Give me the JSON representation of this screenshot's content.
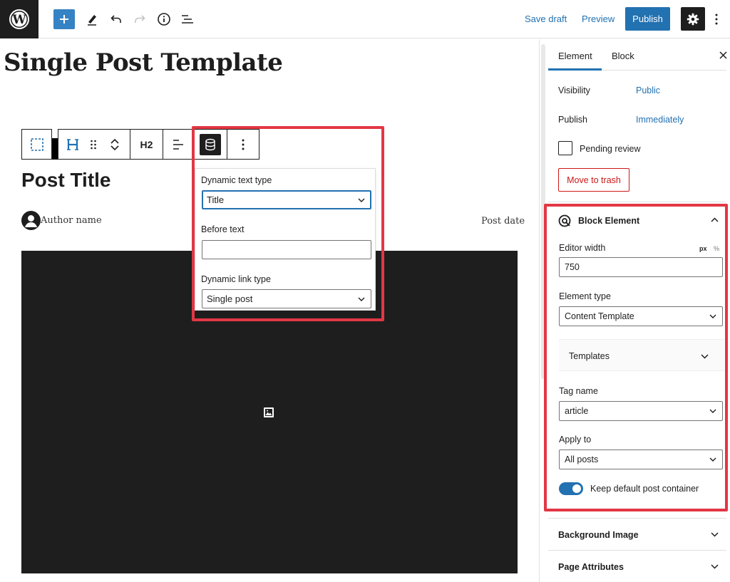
{
  "topbar": {
    "save_draft": "Save draft",
    "preview": "Preview",
    "publish": "Publish"
  },
  "canvas": {
    "document_title": "Single Post Template",
    "toolbar_heading_level": "H2",
    "post_title": "Post Title",
    "author_name": "Author name",
    "post_date": "Post date"
  },
  "popover": {
    "dynamic_text_type_label": "Dynamic text type",
    "dynamic_text_type_value": "Title",
    "before_text_label": "Before text",
    "before_text_value": "",
    "dynamic_link_type_label": "Dynamic link type",
    "dynamic_link_type_value": "Single post"
  },
  "sidebar": {
    "tabs": [
      "Element",
      "Block"
    ],
    "visibility_label": "Visibility",
    "visibility_value": "Public",
    "publish_label": "Publish",
    "publish_value": "Immediately",
    "pending_review": "Pending review",
    "move_to_trash": "Move to trash",
    "block_element": {
      "title": "Block Element",
      "editor_width_label": "Editor width",
      "unit_px": "px",
      "unit_pct": "%",
      "editor_width_value": "750",
      "element_type_label": "Element type",
      "element_type_value": "Content Template",
      "templates_label": "Templates",
      "tag_name_label": "Tag name",
      "tag_name_value": "article",
      "apply_to_label": "Apply to",
      "apply_to_value": "All posts",
      "keep_container_label": "Keep default post container",
      "keep_container_on": true
    },
    "background_image": "Background Image",
    "page_attributes": "Page Attributes"
  },
  "colors": {
    "accent": "#2271b1",
    "highlight": "#e23744",
    "danger": "#cc1818",
    "dark": "#1e1e1e"
  }
}
